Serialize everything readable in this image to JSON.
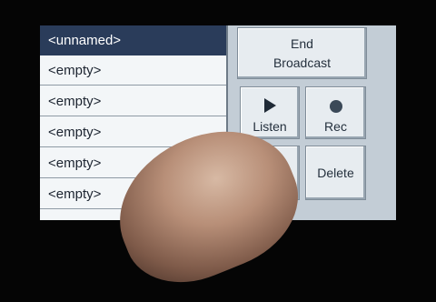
{
  "list": {
    "items": [
      {
        "label": "<unnamed>",
        "selected": true
      },
      {
        "label": "<empty>",
        "selected": false
      },
      {
        "label": "<empty>",
        "selected": false
      },
      {
        "label": "<empty>",
        "selected": false
      },
      {
        "label": "<empty>",
        "selected": false
      },
      {
        "label": "<empty>",
        "selected": false
      }
    ]
  },
  "buttons": {
    "end_broadcast_line1": "End",
    "end_broadcast_line2": "Broadcast",
    "listen": "Listen",
    "rec": "Rec",
    "edit_partial": ". .",
    "delete": "Delete"
  },
  "icons": {
    "listen": "play-icon",
    "rec": "record-icon"
  },
  "colors": {
    "selection": "#2a3c5a",
    "panel": "#c3cdd6",
    "button": "#e7ecf0"
  }
}
